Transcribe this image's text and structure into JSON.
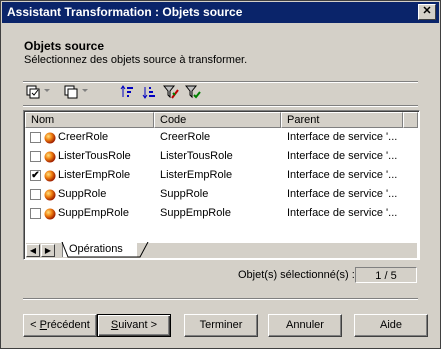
{
  "window": {
    "title": "Assistant Transformation : Objets source"
  },
  "header": {
    "title": "Objets source",
    "subtitle": "Sélectionnez des objets source à transformer."
  },
  "toolbar": {
    "icons": [
      "select-all-icon",
      "deselect-icon",
      "sort-ascending-icon",
      "sort-descending-icon",
      "filter-icon",
      "include-subobjects-icon"
    ]
  },
  "grid": {
    "columns": [
      "Nom",
      "Code",
      "Parent"
    ],
    "rows": [
      {
        "checked": false,
        "name": "CreerRole",
        "code": "CreerRole",
        "parent": "Interface de service '..."
      },
      {
        "checked": false,
        "name": "ListerTousRole",
        "code": "ListerTousRole",
        "parent": "Interface de service '..."
      },
      {
        "checked": true,
        "name": "ListerEmpRole",
        "code": "ListerEmpRole",
        "parent": "Interface de service '..."
      },
      {
        "checked": false,
        "name": "SuppRole",
        "code": "SuppRole",
        "parent": "Interface de service '..."
      },
      {
        "checked": false,
        "name": "SuppEmpRole",
        "code": "SuppEmpRole",
        "parent": "Interface de service '..."
      }
    ],
    "tab": "Opérations"
  },
  "status": {
    "label": "Objet(s) sélectionné(s) :",
    "value": "1 / 5"
  },
  "buttons": {
    "back": {
      "mnemonic": "P",
      "rest": "récédent",
      "prefix": "< "
    },
    "next": {
      "mnemonic": "S",
      "rest": "uivant",
      "suffix": " >"
    },
    "finish": "Terminer",
    "cancel": "Annuler",
    "help": "Aide"
  },
  "colors": {
    "titlebar": "#0a246a",
    "face": "#d4d0c8",
    "checkmark": "#000000"
  }
}
